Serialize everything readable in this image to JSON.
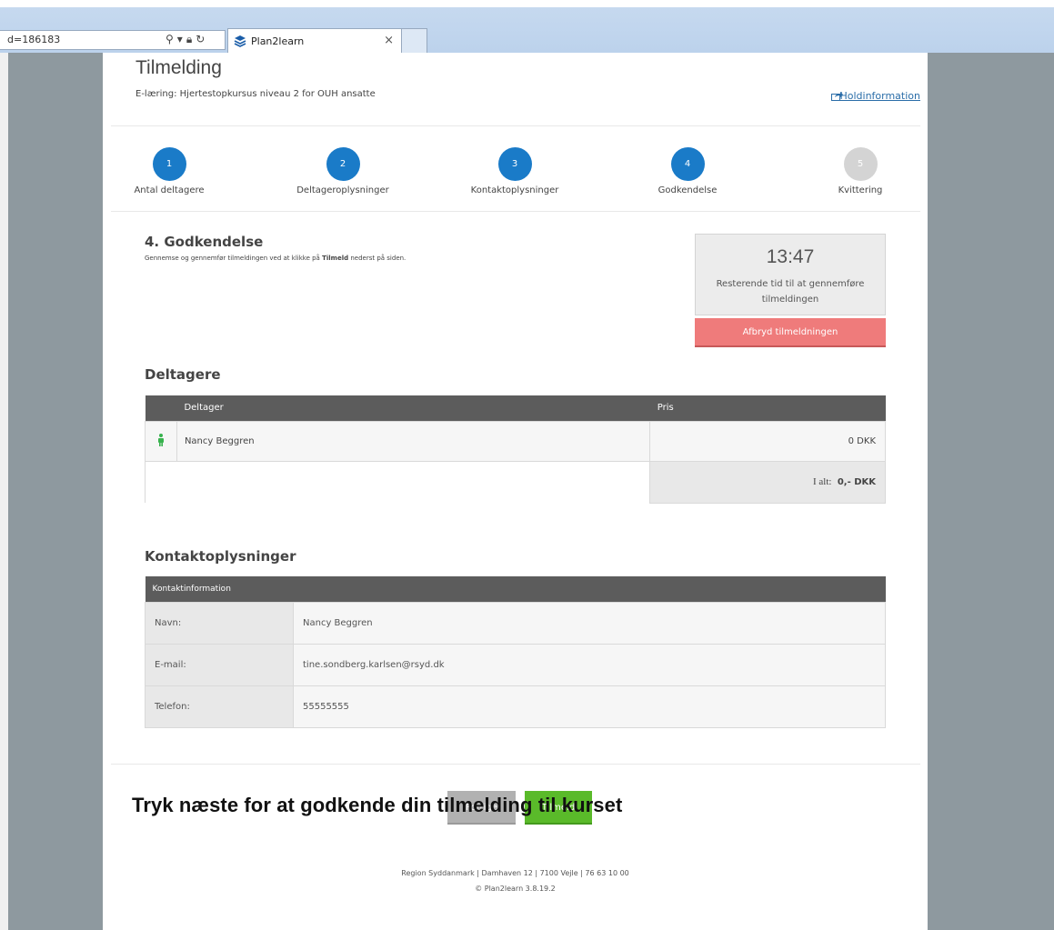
{
  "browser": {
    "address_text": "d=186183",
    "tab_title": "Plan2learn",
    "tab_close": "×"
  },
  "header": {
    "title": "Tilmelding",
    "course": "E-læring: Hjertestopkursus niveau 2 for OUH ansatte",
    "holdinfo_link": "Holdinformation"
  },
  "steps": [
    {
      "num": "1",
      "label": "Antal deltagere",
      "state": "done"
    },
    {
      "num": "2",
      "label": "Deltageroplysninger",
      "state": "done"
    },
    {
      "num": "3",
      "label": "Kontaktoplysninger",
      "state": "done"
    },
    {
      "num": "4",
      "label": "Godkendelse",
      "state": "current"
    },
    {
      "num": "5",
      "label": "Kvittering",
      "state": "pending"
    }
  ],
  "approval": {
    "heading": "4. Godkendelse",
    "instruction_pre": "Gennemse og gennemfør tilmeldingen ved at klikke på ",
    "instruction_bold": "Tilmeld",
    "instruction_post": " nederst på siden."
  },
  "timer": {
    "value": "13:47",
    "text": "Resterende tid til at gennemføre tilmeldingen",
    "abort_label": "Afbryd tilmeldningen"
  },
  "participants": {
    "heading": "Deltagere",
    "col_participant": "Deltager",
    "col_price": "Pris",
    "rows": [
      {
        "name": "Nancy Beggren",
        "price": "0 DKK"
      }
    ],
    "total_label": "I alt:",
    "total_value": "0,- DKK"
  },
  "contact": {
    "heading": "Kontaktoplysninger",
    "table_header": "Kontaktinformation",
    "rows": [
      {
        "label": "Navn:",
        "value": "Nancy Beggren"
      },
      {
        "label": "E-mail:",
        "value": "tine.sondberg.karlsen@rsyd.dk"
      },
      {
        "label": "Telefon:",
        "value": "55555555"
      }
    ]
  },
  "buttons": {
    "prev": "Forrige",
    "next": "Tilmeld"
  },
  "footer": {
    "line1": "Region Syddanmark | Damhaven 12 | 7100 Vejle | 76 63 10 00",
    "line2": "© Plan2learn 3.8.19.2"
  },
  "overlay_caption": "Tryk næste for at godkende din tilmelding til kurset",
  "colors": {
    "primary": "#1a7bc8",
    "abort": "#ef7b7b",
    "submit": "#5aba2a",
    "table_header": "#5c5c5c"
  }
}
